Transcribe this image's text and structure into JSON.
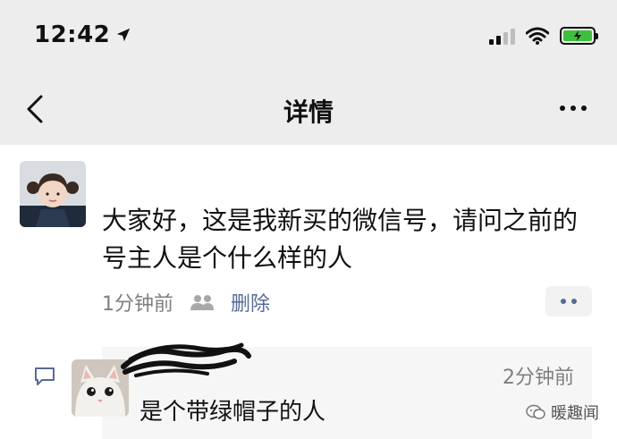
{
  "status_bar": {
    "time": "12:42",
    "location_icon": "location-arrow-icon",
    "signal_icon": "cellular-signal-icon",
    "wifi_icon": "wifi-icon",
    "battery_icon": "battery-charging-icon"
  },
  "nav": {
    "back_icon": "chevron-left-icon",
    "title": "详情",
    "more_icon": "ellipsis-icon"
  },
  "post": {
    "text": "大家好，这是我新买的微信号，请问之前的号主人是个什么样的人",
    "time": "1分钟前",
    "visibility_icon": "friends-icon",
    "delete_label": "删除",
    "more_icon": "ellipsis-icon"
  },
  "comments": [
    {
      "icon": "comment-icon",
      "time": "2分钟前",
      "text": "是个带绿帽子的人"
    }
  ],
  "watermark": {
    "icon": "wechat-icon",
    "text": "暖趣闻"
  },
  "colors": {
    "header_bg": "#ededed",
    "link": "#576b95",
    "meta_text": "#7f7f7f",
    "comment_bg": "#f6f6f6",
    "battery": "#3fbf3f"
  }
}
